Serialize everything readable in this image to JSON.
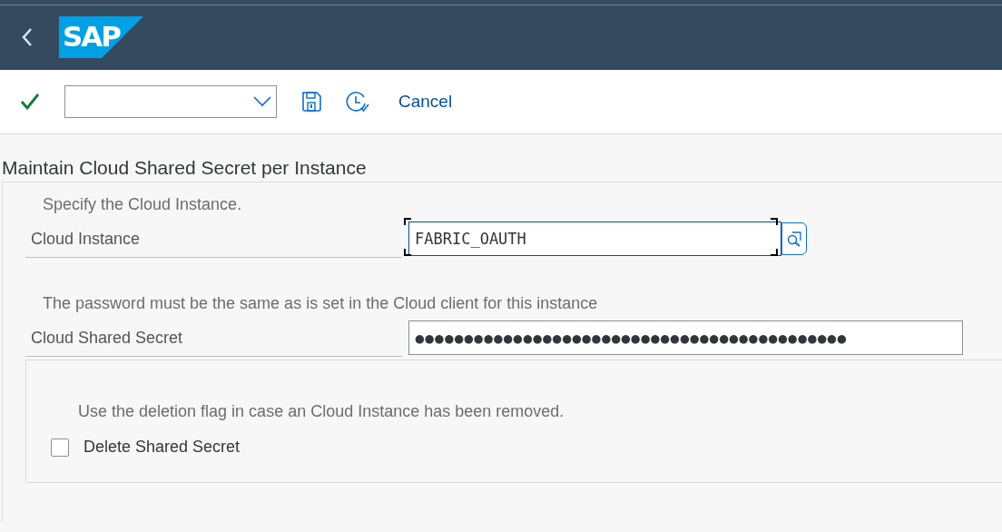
{
  "header": {
    "logo": "SAP"
  },
  "toolbar": {
    "buttons": [
      {
        "kind": "save"
      },
      {
        "kind": "history"
      }
    ],
    "cancel": "Cancel"
  },
  "title": "Maintain Cloud Shared Secret per Instance",
  "sections": [
    {
      "kind": "field",
      "hint": "Specify the Cloud Instance.",
      "label": "Cloud Instance",
      "value": "FABRIC_OAUTH",
      "focused": true,
      "search_help": true
    },
    {
      "kind": "field",
      "hint": "The password must be the same as is set in the Cloud client for this instance",
      "label": "Cloud Shared Secret",
      "value": "●●●●●●●●●●●●●●●●●●●●●●●●●●●●●●●●●●●●●●●●●●●●",
      "focused": false,
      "search_help": false
    },
    {
      "kind": "checkbox",
      "hint": "Use the deletion flag in case an Cloud Instance has been removed.",
      "label": "Delete Shared Secret",
      "checked": false
    }
  ]
}
